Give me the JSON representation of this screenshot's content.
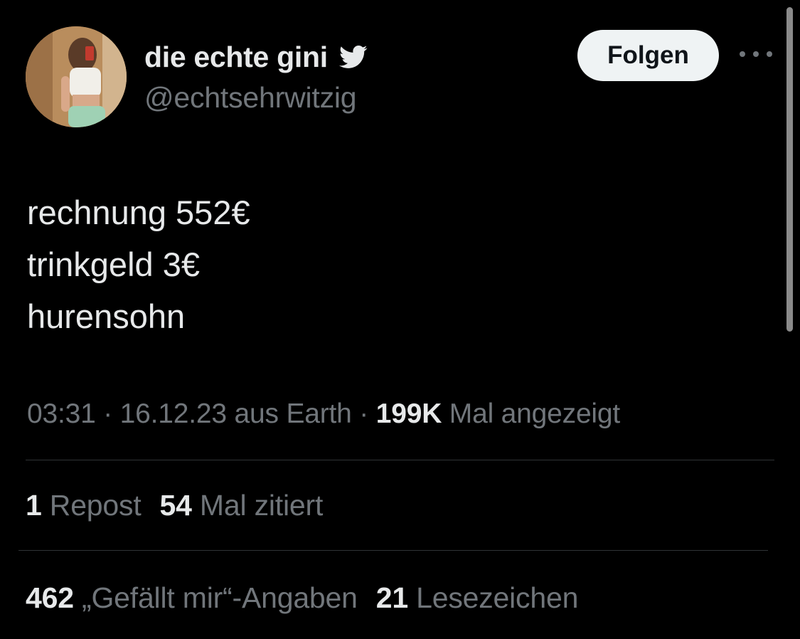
{
  "author": {
    "display_name": "die echte gini",
    "handle": "@echtsehrwitzig",
    "badge_icon": "twitter-bird-icon"
  },
  "follow_button": {
    "label": "Folgen"
  },
  "more_menu": {
    "icon": "more-horizontal-icon"
  },
  "tweet": {
    "lines": [
      "rechnung 552€",
      "trinkgeld 3€",
      "hurensohn"
    ]
  },
  "meta": {
    "time": "03:31",
    "sep1": " · ",
    "date": "16.12.23",
    "location_text": " aus Earth",
    "sep2": " · ",
    "views_count": "199K",
    "views_label": " Mal angezeigt"
  },
  "stats_reposts": {
    "repost_count": "1",
    "repost_label": " Repost",
    "quote_count": "54",
    "quote_label": " Mal zitiert"
  },
  "stats_likes": {
    "like_count": "462",
    "like_label": " „Gefällt mir“-Angaben",
    "bookmark_count": "21",
    "bookmark_label": " Lesezeichen"
  },
  "colors": {
    "background": "#000000",
    "primary_text": "#e7e9ea",
    "secondary_text": "#71767b",
    "divider": "#2f3336",
    "button_bg": "#eff3f4"
  }
}
